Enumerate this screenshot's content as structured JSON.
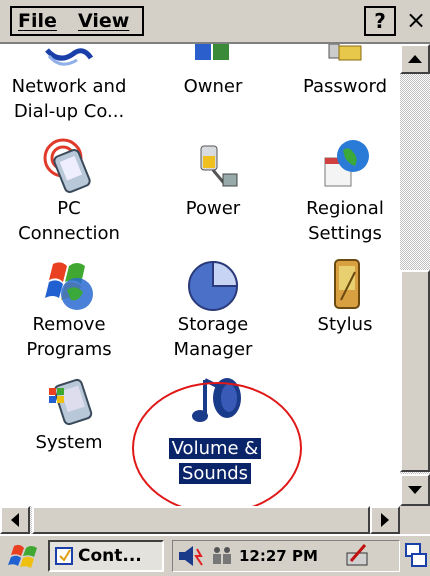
{
  "menu": {
    "file": "File",
    "view": "View",
    "help": "?",
    "close": "×"
  },
  "items": [
    {
      "label_line1": "Network and",
      "label_line2": "Dial-up Co...",
      "icon": "network-icon"
    },
    {
      "label_line1": "Owner",
      "label_line2": "",
      "icon": "owner-icon"
    },
    {
      "label_line1": "Password",
      "label_line2": "",
      "icon": "password-icon"
    },
    {
      "label_line1": "PC",
      "label_line2": "Connection",
      "icon": "pc-connection-icon"
    },
    {
      "label_line1": "Power",
      "label_line2": "",
      "icon": "power-icon"
    },
    {
      "label_line1": "Regional",
      "label_line2": "Settings",
      "icon": "regional-settings-icon"
    },
    {
      "label_line1": "Remove",
      "label_line2": "Programs",
      "icon": "remove-programs-icon"
    },
    {
      "label_line1": "Storage",
      "label_line2": "Manager",
      "icon": "storage-manager-icon"
    },
    {
      "label_line1": "Stylus",
      "label_line2": "",
      "icon": "stylus-icon"
    },
    {
      "label_line1": "System",
      "label_line2": "",
      "icon": "system-icon"
    },
    {
      "label_line1": "Volume &",
      "label_line2": "Sounds",
      "icon": "volume-sounds-icon",
      "selected": true
    }
  ],
  "taskbar": {
    "task_label": "Cont...",
    "clock": "12:27 PM"
  },
  "colors": {
    "selection": "#0a246a",
    "highlight_circle": "#e01818",
    "chrome": "#d4d0c8"
  }
}
